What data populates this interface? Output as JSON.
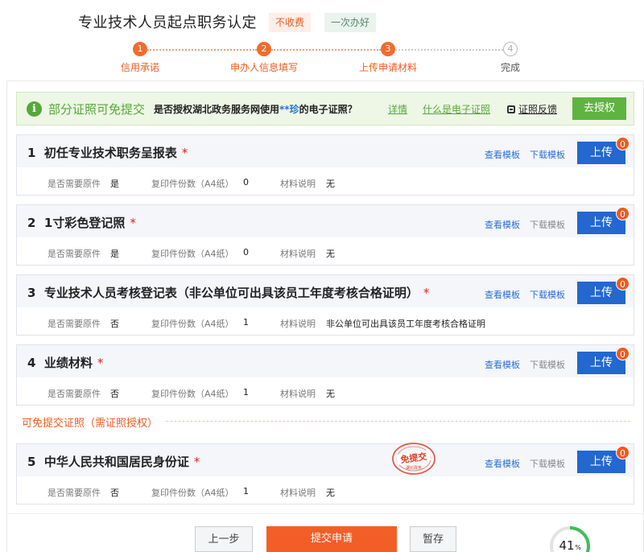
{
  "header": {
    "title": "专业技术人员起点职务认定",
    "tag_fee": "不收费",
    "tag_once": "一次办好"
  },
  "steps": [
    {
      "num": "1",
      "label": "信用承诺",
      "state": "done"
    },
    {
      "num": "2",
      "label": "申办人信息填写",
      "state": "done"
    },
    {
      "num": "3",
      "label": "上传申请材料",
      "state": "current"
    },
    {
      "num": "4",
      "label": "完成",
      "state": "pending"
    }
  ],
  "notice": {
    "icon": "info-icon",
    "title": "部分证照可免提交",
    "question_prefix": "是否授权湖北政务服务网使用",
    "question_name": "**珍",
    "question_suffix": "的电子证照？",
    "link_detail": "详情",
    "link_what": "什么是电子证照",
    "feedback": "证照反馈",
    "auth_button": "去授权"
  },
  "meta_labels": {
    "original": "是否需要原件",
    "copies": "复印件份数（A4纸）",
    "desc": "材料说明"
  },
  "actions": {
    "view_template": "查看模板",
    "download_template": "下载模板",
    "upload": "上传"
  },
  "materials": [
    {
      "no": "1",
      "name": "初任专业技术职务呈报表",
      "required": "*",
      "original": "是",
      "copies": "0",
      "desc": "无",
      "upload_count": "0",
      "download_enabled": true
    },
    {
      "no": "2",
      "name": "1寸彩色登记照",
      "required": "*",
      "original": "是",
      "copies": "0",
      "desc": "无",
      "upload_count": "0",
      "download_enabled": false
    },
    {
      "no": "3",
      "name": "专业技术人员考核登记表（非公单位可出具该员工年度考核合格证明）",
      "required": "*",
      "original": "否",
      "copies": "1",
      "desc": "非公单位可出具该员工年度考核合格证明",
      "upload_count": "0",
      "download_enabled": true
    },
    {
      "no": "4",
      "name": "业绩材料",
      "required": "*",
      "original": "否",
      "copies": "1",
      "desc": "无",
      "upload_count": "0",
      "download_enabled": false
    }
  ],
  "exempt_section": {
    "label": "可免提交证照（需证照授权）",
    "stamp_text": "免提交",
    "stamp_sub": "湖北政务",
    "materials": [
      {
        "no": "5",
        "name": "中华人民共和国居民身份证",
        "required": "*",
        "original": "否",
        "copies": "1",
        "desc": "无",
        "upload_count": "0",
        "download_enabled": false
      }
    ]
  },
  "footer": {
    "prev": "上一步",
    "submit": "提交申请",
    "save": "暂存"
  },
  "progress": {
    "value": "41",
    "unit": "%",
    "fraction": 0.41
  },
  "colors": {
    "accent": "#f26b2c",
    "primary": "#2367cf",
    "green": "#5fb341",
    "required": "#e02020"
  }
}
